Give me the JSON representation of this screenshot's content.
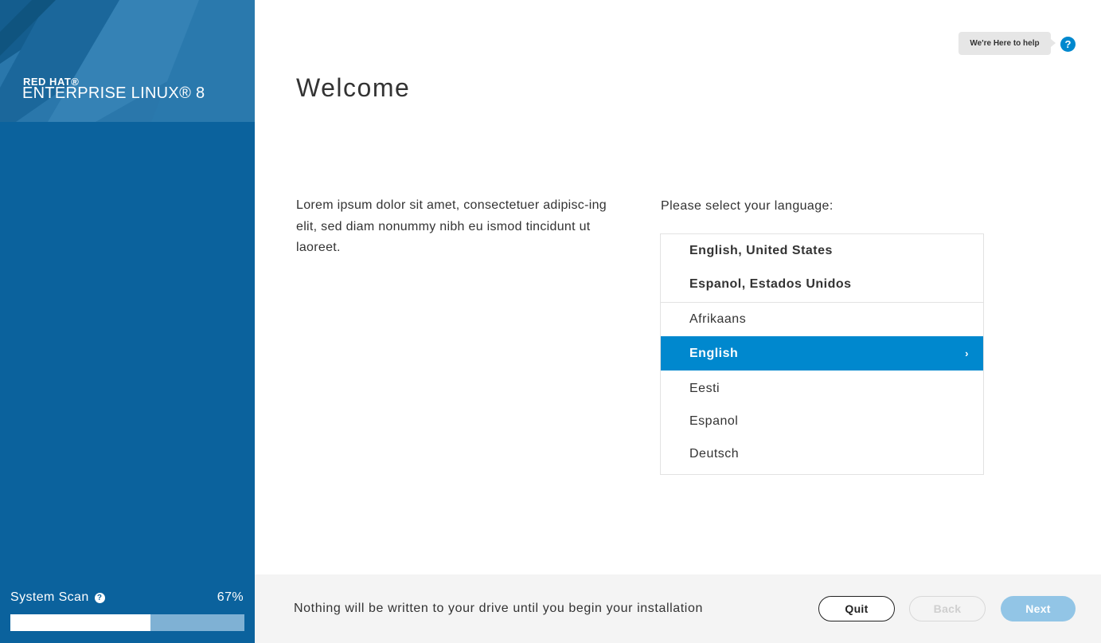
{
  "brand": {
    "line1": "RED HAT®",
    "line2": "ENTERPRISE LINUX® 8"
  },
  "sidebar": {
    "scan_label": "System Scan",
    "scan_help_glyph": "?",
    "scan_percent": "67%",
    "scan_progress": 0.6
  },
  "help": {
    "label": "We're Here to help",
    "icon_glyph": "?"
  },
  "page": {
    "title": "Welcome",
    "intro": "Lorem ipsum dolor sit amet, consectetuer adipisc-ing elit, sed diam nonummy nibh eu ismod tincidunt ut laoreet.",
    "language_prompt": "Please select your language:"
  },
  "languages": {
    "suggested": [
      "English, United States",
      "Espanol, Estados Unidos"
    ],
    "items": [
      "Afrikaans",
      "English",
      "Eesti",
      "Espanol",
      "Deutsch"
    ],
    "selected": "English",
    "selected_chevron": "›"
  },
  "footer": {
    "message": "Nothing will be written to your drive until you begin your installation",
    "quit_label": "Quit",
    "back_label": "Back",
    "next_label": "Next"
  },
  "colors": {
    "sidebar_bg": "#0b629d",
    "accent": "#0088ce",
    "next_disabled": "#92c5e6"
  },
  "icons": {
    "help": "question-circle-icon",
    "chevron": "chevron-right-icon"
  }
}
